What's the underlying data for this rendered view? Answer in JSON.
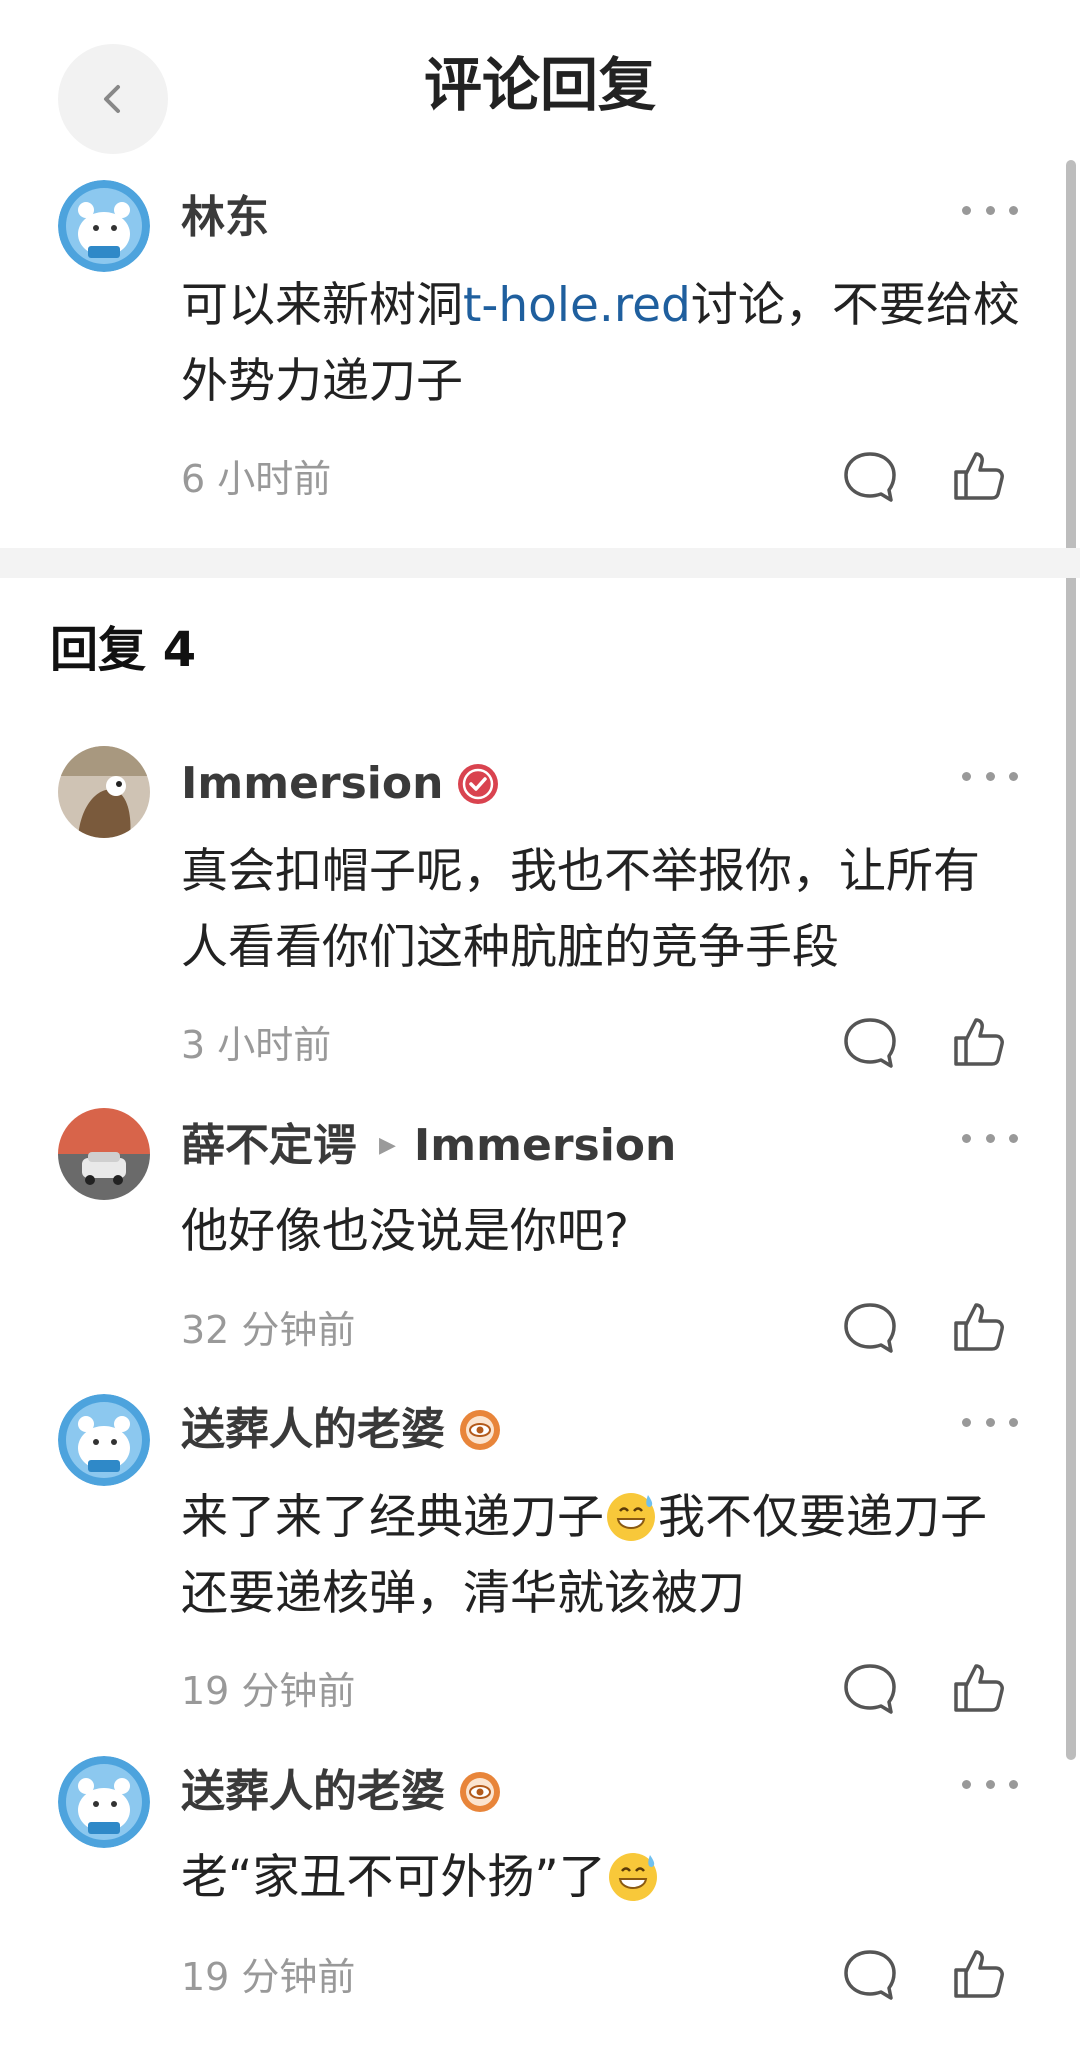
{
  "header": {
    "title": "评论回复"
  },
  "main_comment": {
    "author": "林东",
    "content_before": "可以来新树洞",
    "link": "t-hole.red",
    "content_after": "讨论，不要给校外势力递刀子",
    "time": "6 小时前"
  },
  "replies_section": {
    "title": "回复 4"
  },
  "replies": [
    {
      "author": "Immersion",
      "badge": "verified-check-badge",
      "content": "真会扣帽子呢，我也不举报你，让所有人看看你们这种肮脏的竞争手段",
      "time": "3 小时前"
    },
    {
      "author": "薛不定谔",
      "reply_to": "Immersion",
      "content": "他好像也没说是你吧?",
      "time": "32 分钟前"
    },
    {
      "author": "送葬人的老婆",
      "badge": "eye-badge",
      "content_part1": "来了来了经典递刀子",
      "content_part2": "我不仅要递刀子还要递核弹，清华就该被刀",
      "time": "19 分钟前"
    },
    {
      "author": "送葬人的老婆",
      "badge": "eye-badge",
      "content": "老“家丑不可外扬”了",
      "time": "19 分钟前"
    }
  ],
  "colors": {
    "link": "#1f5f9e",
    "badge_verified": "#d9434f",
    "badge_eye": "#e8853a"
  }
}
